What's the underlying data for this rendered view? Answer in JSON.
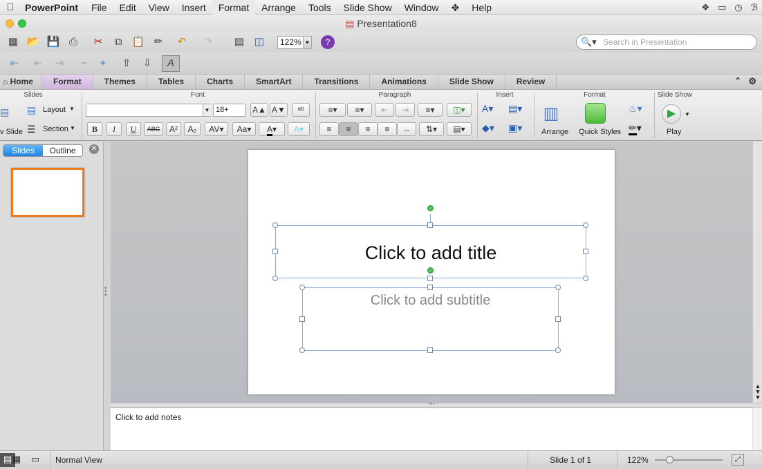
{
  "menubar": {
    "app": "PowerPoint",
    "items": [
      "File",
      "Edit",
      "View",
      "Insert",
      "Format",
      "Arrange",
      "Tools",
      "Slide Show",
      "Window",
      "Help"
    ],
    "active_item": "Format"
  },
  "window": {
    "title": "Presentation8"
  },
  "toolbar": {
    "zoom": "122%",
    "search_placeholder": "Search in Presentation"
  },
  "ribbon_tabs": {
    "home": "Home",
    "items": [
      "Format",
      "Themes",
      "Tables",
      "Charts",
      "SmartArt",
      "Transitions",
      "Animations",
      "Slide Show",
      "Review"
    ],
    "selected": "Format"
  },
  "ribbon": {
    "groups": {
      "slides": "Slides",
      "font": "Font",
      "paragraph": "Paragraph",
      "insert": "Insert",
      "format": "Format",
      "slideshow": "Slide Show"
    },
    "layout": "Layout",
    "section": "Section",
    "new_slide": "v Slide",
    "font_size": "18+",
    "arrange": "Arrange",
    "quick_styles": "Quick Styles",
    "play": "Play"
  },
  "left_panel": {
    "tab_slides": "Slides",
    "tab_outline": "Outline",
    "selected": "Slides"
  },
  "slide": {
    "title_placeholder": "Click to add title",
    "subtitle_placeholder": "Click to add subtitle"
  },
  "notes": {
    "placeholder": "Click to add notes"
  },
  "status": {
    "view": "Normal View",
    "slide_count": "Slide 1 of 1",
    "zoom": "122%",
    "zoom_level": 0.22
  },
  "colors": {
    "accent_tab": "#d7bfe5",
    "thumb_border": "#ee7b1c",
    "selection": "#90aed8",
    "rotate_handle": "#4fc25c"
  }
}
